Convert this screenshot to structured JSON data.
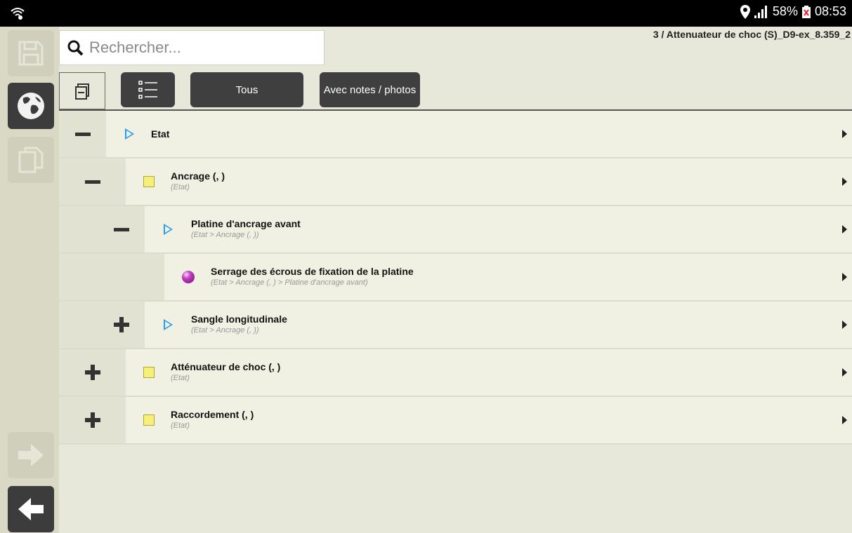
{
  "status_bar": {
    "battery": "58%",
    "time": "08:53"
  },
  "header": {
    "breadcrumb": "3 / Attenuateur de choc (S)_D9-ex_8.359_2"
  },
  "search": {
    "placeholder": "Rechercher..."
  },
  "toolbar": {
    "tous_label": "Tous",
    "notes_label": "Avec notes / photos"
  },
  "tree": [
    {
      "title": "Etat",
      "path": "",
      "icon": "blue-triangle",
      "toggle": "minus"
    },
    {
      "title": "Ancrage (, )",
      "path": "(Etat)",
      "icon": "yellow-square",
      "toggle": "minus"
    },
    {
      "title": "Platine d'ancrage avant",
      "path": "(Etat > Ancrage (, ))",
      "icon": "blue-triangle",
      "toggle": "minus"
    },
    {
      "title": "Serrage des écrous de fixation de la platine",
      "path": "(Etat > Ancrage (, ) > Platine d'ancrage avant)",
      "icon": "purple-ball",
      "toggle": "none"
    },
    {
      "title": "Sangle longitudinale",
      "path": "(Etat > Ancrage (, ))",
      "icon": "blue-triangle",
      "toggle": "plus"
    },
    {
      "title": "Atténuateur de choc (, )",
      "path": "(Etat)",
      "icon": "yellow-square",
      "toggle": "plus"
    },
    {
      "title": "Raccordement (, )",
      "path": "(Etat)",
      "icon": "yellow-square",
      "toggle": "plus"
    }
  ],
  "colors": {
    "accent_blue": "#2a9be8",
    "sidebar": "#d9d9c6",
    "dark_button": "#3f3f3f"
  }
}
